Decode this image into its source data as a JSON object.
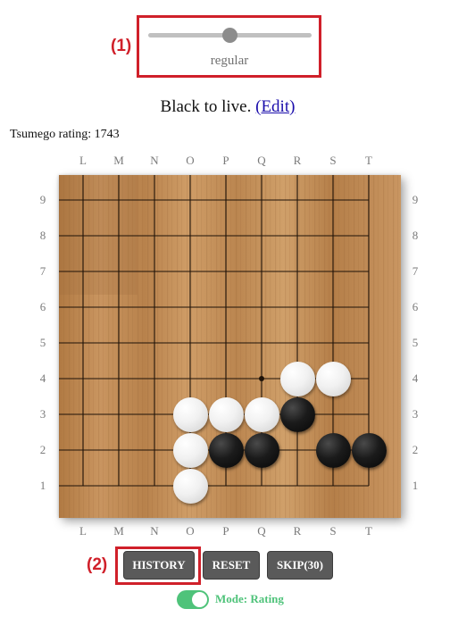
{
  "colors": {
    "annotation": "#d0202a",
    "toggle_on": "#4fc37a",
    "button_bg": "#5a5a5a",
    "link": "#1a0dab",
    "board_wood": "#c08b55"
  },
  "annotations": [
    {
      "label": "(1)"
    },
    {
      "label": "(2)"
    }
  ],
  "difficulty_slider": {
    "caption": "regular",
    "value": 0.5
  },
  "problem": {
    "instruction": "Black to live.",
    "edit_link": "(Edit)"
  },
  "rating": {
    "text": "Tsumego rating: 1743"
  },
  "board": {
    "columns": [
      "L",
      "M",
      "N",
      "O",
      "P",
      "Q",
      "R",
      "S",
      "T"
    ],
    "rows": [
      "9",
      "8",
      "7",
      "6",
      "5",
      "4",
      "3",
      "2",
      "1"
    ],
    "stones": [
      {
        "color": "white",
        "point": "R4"
      },
      {
        "color": "white",
        "point": "S4"
      },
      {
        "color": "white",
        "point": "O3"
      },
      {
        "color": "white",
        "point": "P3"
      },
      {
        "color": "white",
        "point": "Q3"
      },
      {
        "color": "black",
        "point": "R3"
      },
      {
        "color": "white",
        "point": "O2"
      },
      {
        "color": "black",
        "point": "P2"
      },
      {
        "color": "black",
        "point": "Q2"
      },
      {
        "color": "black",
        "point": "S2"
      },
      {
        "color": "black",
        "point": "T2"
      },
      {
        "color": "white",
        "point": "O1"
      }
    ]
  },
  "buttons": {
    "history": "HISTORY",
    "reset": "RESET",
    "skip": "SKIP(30)"
  },
  "mode": {
    "label": "Mode: Rating",
    "enabled": true
  }
}
